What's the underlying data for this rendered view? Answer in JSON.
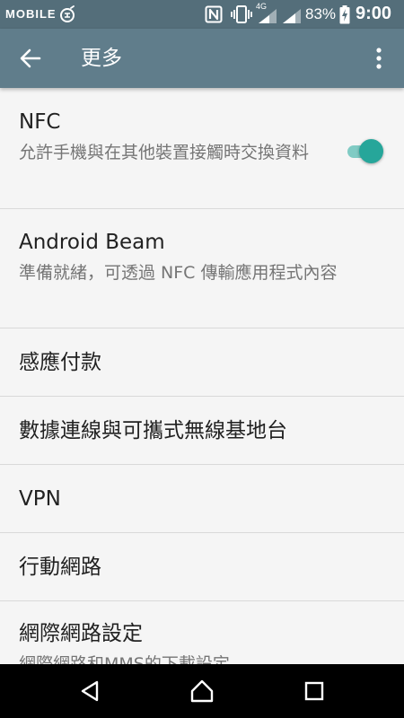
{
  "status_bar": {
    "brand": "MOBILE",
    "network_type": "4G",
    "battery_percent": "83%",
    "time": "9:00",
    "icons": [
      "nfc-icon",
      "vibrate-icon",
      "signal-icon",
      "signal-icon",
      "battery-charging-icon"
    ]
  },
  "app_bar": {
    "title": "更多",
    "back_icon": "arrow-back-icon",
    "menu_icon": "more-vert-icon"
  },
  "settings": [
    {
      "title": "NFC",
      "summary": "允許手機與在其他裝置接觸時交換資料",
      "toggle": {
        "on": true
      }
    },
    {
      "title": "Android Beam",
      "summary": "準備就緒，可透過 NFC 傳輸應用程式內容"
    },
    {
      "title": "感應付款"
    },
    {
      "title": "數據連線與可攜式無線基地台"
    },
    {
      "title": "VPN"
    },
    {
      "title": "行動網路"
    },
    {
      "title": "網際網路設定",
      "summary": "網際網路和MMS的下載設定"
    }
  ],
  "nav_bar": {
    "icons": [
      "back-triangle-icon",
      "home-icon",
      "recents-icon"
    ]
  },
  "colors": {
    "status_bar": "#546e7a",
    "app_bar": "#607d8b",
    "accent": "#26a69a",
    "background": "#f5f5f5",
    "divider": "#d9d9d9"
  }
}
